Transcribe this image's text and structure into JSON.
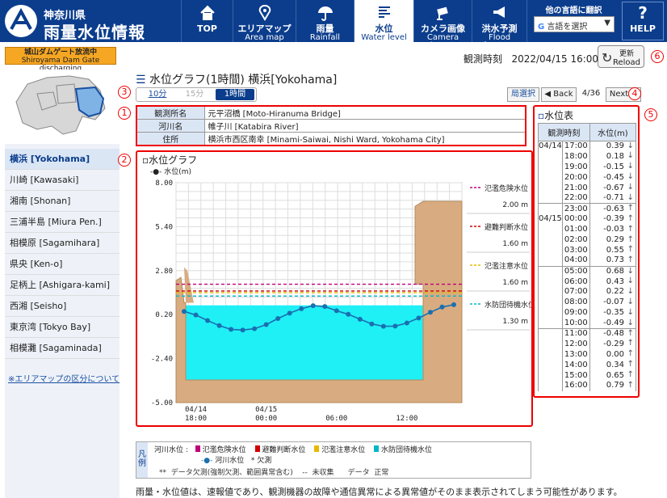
{
  "header": {
    "logo_small": "神奈川県",
    "logo_big": "雨量水位情報",
    "nav": [
      {
        "l1": "TOP",
        "l2": ""
      },
      {
        "l1": "エリアマップ",
        "l2": "Area map"
      },
      {
        "l1": "雨量",
        "l2": "Rainfall"
      },
      {
        "l1": "水位",
        "l2": "Water level"
      },
      {
        "l1": "カメラ画像",
        "l2": "Camera image"
      },
      {
        "l1": "洪水予測",
        "l2": "Flood forecast"
      }
    ],
    "lang_title": "他の言語に翻訳",
    "lang_select": "言語を選択",
    "help": "HELP"
  },
  "dam_notice": {
    "l1": "城山ダムゲート放流中",
    "l2": "Shiroyama Dam Gate discharging"
  },
  "obs_time_label": "観測時刻",
  "obs_time": "2022/04/15 16:00",
  "reload": {
    "l1": "更新",
    "l2": "Reload"
  },
  "page_title": "水位グラフ(1時間) 横浜[Yokohama]",
  "tabs": [
    "10分",
    "15分",
    "1時間"
  ],
  "pager": {
    "list": "局選択",
    "back": "◀ Back",
    "count": "4/36",
    "next": "Next ▶"
  },
  "info": [
    {
      "k": "観測所名",
      "v": "元平沼橋 [Moto-Hiranuma Bridge]"
    },
    {
      "k": "河川名",
      "v": "帷子川 [Katabira River]"
    },
    {
      "k": "住所",
      "v": "横浜市西区南幸 [Minami-Saiwai, Nishi Ward, Yokohama City]"
    }
  ],
  "sidebar": {
    "items": [
      "横浜 [Yokohama]",
      "川崎 [Kawasaki]",
      "湘南 [Shonan]",
      "三浦半島 [Miura Pen.]",
      "相模原 [Sagamihara]",
      "県央 [Ken-o]",
      "足柄上 [Ashigara-kami]",
      "西湘 [Seisho]",
      "東京湾 [Tokyo Bay]",
      "相模灘 [Sagaminada]"
    ],
    "link": "※エリアマップの区分について"
  },
  "circle_labels": [
    "1",
    "2",
    "3",
    "4",
    "5",
    "6"
  ],
  "chart_data": {
    "type": "line",
    "title": "水位グラフ",
    "series_name": "水位(m)",
    "ylim": [
      -5.0,
      8.0
    ],
    "yticks": [
      "8.00",
      "5.40",
      "2.80",
      "0.20",
      "-2.40",
      "-5.00"
    ],
    "xticks": [
      {
        "l1": "04/14",
        "l2": "18:00",
        "h": 0
      },
      {
        "l1": "04/15",
        "l2": "00:00",
        "h": 6
      },
      {
        "l1": "",
        "l2": "06:00",
        "h": 12
      },
      {
        "l1": "",
        "l2": "12:00",
        "h": 18
      }
    ],
    "x_hours": [
      0,
      1,
      2,
      3,
      4,
      5,
      6,
      7,
      8,
      9,
      10,
      11,
      12,
      13,
      14,
      15,
      16,
      17,
      18,
      19,
      20,
      21,
      22
    ],
    "values": [
      0.39,
      0.18,
      -0.15,
      -0.45,
      -0.67,
      -0.71,
      -0.63,
      -0.39,
      -0.03,
      0.29,
      0.55,
      0.73,
      0.68,
      0.43,
      0.22,
      -0.07,
      -0.35,
      -0.49,
      -0.48,
      -0.29,
      0.0,
      0.34,
      0.65,
      0.79
    ],
    "thresholds": [
      {
        "label": "氾濫危険水位",
        "value": 2.0,
        "text": "2.00 m",
        "color": "#c0007a"
      },
      {
        "label": "避難判断水位",
        "value": 1.6,
        "text": "1.60 m",
        "color": "#d00000"
      },
      {
        "label": "氾濫注意水位",
        "value": 1.6,
        "text": "1.60 m",
        "color": "#e8b800"
      },
      {
        "label": "水防団待機水位",
        "value": 1.3,
        "text": "1.30 m",
        "color": "#00b8c8"
      }
    ]
  },
  "water_table": {
    "title": "水位表",
    "col_time": "観測時刻",
    "col_value": "水位(m)",
    "rows": [
      {
        "d": "04/14",
        "t": "17:00",
        "v": "0.39",
        "a": "↓"
      },
      {
        "d": "",
        "t": "18:00",
        "v": "0.18",
        "a": "↓"
      },
      {
        "d": "",
        "t": "19:00",
        "v": "-0.15",
        "a": "↓"
      },
      {
        "d": "",
        "t": "20:00",
        "v": "-0.45",
        "a": "↓"
      },
      {
        "d": "",
        "t": "21:00",
        "v": "-0.67",
        "a": "↓"
      },
      {
        "d": "",
        "t": "22:00",
        "v": "-0.71",
        "a": "↓"
      },
      {
        "d": "",
        "t": "23:00",
        "v": "-0.63",
        "a": "↑"
      },
      {
        "d": "04/15",
        "t": "00:00",
        "v": "-0.39",
        "a": "↑"
      },
      {
        "d": "",
        "t": "01:00",
        "v": "-0.03",
        "a": "↑"
      },
      {
        "d": "",
        "t": "02:00",
        "v": "0.29",
        "a": "↑"
      },
      {
        "d": "",
        "t": "03:00",
        "v": "0.55",
        "a": "↑"
      },
      {
        "d": "",
        "t": "04:00",
        "v": "0.73",
        "a": "↑"
      },
      {
        "d": "",
        "t": "05:00",
        "v": "0.68",
        "a": "↓"
      },
      {
        "d": "",
        "t": "06:00",
        "v": "0.43",
        "a": "↓"
      },
      {
        "d": "",
        "t": "07:00",
        "v": "0.22",
        "a": "↓"
      },
      {
        "d": "",
        "t": "08:00",
        "v": "-0.07",
        "a": "↓"
      },
      {
        "d": "",
        "t": "09:00",
        "v": "-0.35",
        "a": "↓"
      },
      {
        "d": "",
        "t": "10:00",
        "v": "-0.49",
        "a": "↓"
      },
      {
        "d": "",
        "t": "11:00",
        "v": "-0.48",
        "a": "↑"
      },
      {
        "d": "",
        "t": "12:00",
        "v": "-0.29",
        "a": "↑"
      },
      {
        "d": "",
        "t": "13:00",
        "v": "0.00",
        "a": "↑"
      },
      {
        "d": "",
        "t": "14:00",
        "v": "0.34",
        "a": "↑"
      },
      {
        "d": "",
        "t": "15:00",
        "v": "0.65",
        "a": "↑"
      },
      {
        "d": "",
        "t": "16:00",
        "v": "0.79",
        "a": "↑"
      }
    ]
  },
  "legend": {
    "side": "凡例",
    "river_label": "河川水位 :",
    "items": [
      "氾濫危険水位",
      "避難判断水位",
      "氾濫注意水位",
      "水防団待機水位"
    ],
    "colors": [
      "#c0007a",
      "#d00000",
      "#e8b800",
      "#00b8c8"
    ],
    "line_label": "河川水位",
    "missing_mark": "*",
    "missing_label": "欠測",
    "r2a": "**",
    "r2b": "データ欠測(強制欠測、範囲異常含む)",
    "r2c": "--",
    "r2d": "未収集",
    "r2e": "データ",
    "r2f": "正常"
  },
  "note": "雨量・水位値は、速報値であり、観測機器の故障や通信異常による異常値がそのまま表示されてしまう可能性があります。"
}
